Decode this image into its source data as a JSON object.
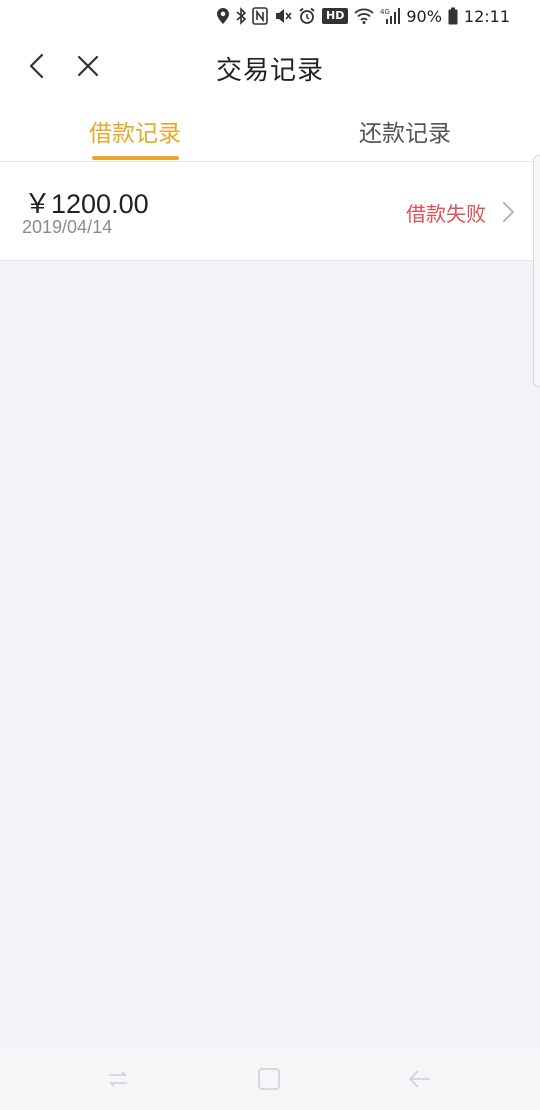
{
  "status_bar": {
    "battery": "90%",
    "time": "12:11",
    "hd_badge": "HD",
    "network": "4G",
    "icons": [
      "location-icon",
      "bluetooth-icon",
      "nfc-icon",
      "mute-icon",
      "alarm-icon",
      "hd-icon",
      "wifi-icon",
      "signal-icon",
      "battery-icon"
    ]
  },
  "header": {
    "title": "交易记录",
    "back_icon": "back-icon",
    "close_icon": "close-icon"
  },
  "tabs": [
    {
      "label": "借款记录",
      "active": true
    },
    {
      "label": "还款记录",
      "active": false
    }
  ],
  "records": [
    {
      "amount": "￥1200.00",
      "date": "2019/04/14",
      "status": "借款失败"
    }
  ],
  "colors": {
    "accent": "#e6a92b",
    "status_failed": "#e05252",
    "background": "#f3f2f7"
  },
  "nav_bar": {
    "icons": [
      "recent-apps-icon",
      "home-icon",
      "back-nav-icon"
    ]
  }
}
